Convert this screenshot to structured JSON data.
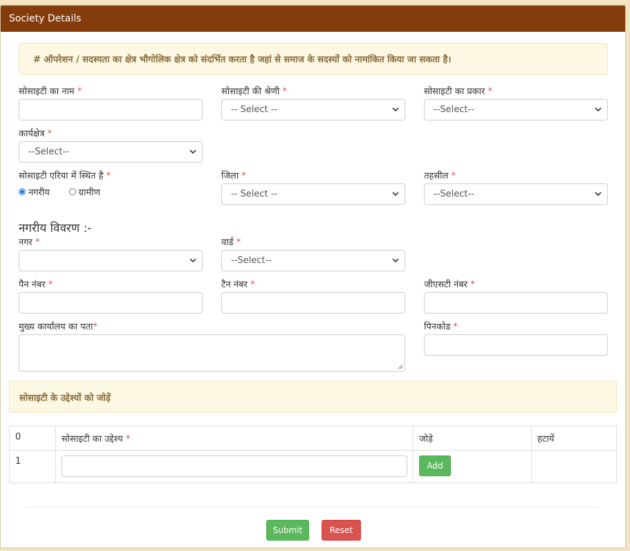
{
  "header": {
    "title": "Society Details"
  },
  "note": "# ऑपरेशन / सदस्यता का क्षेत्र भौगोलिक क्षेत्र को संदर्भित करता है जहां से समाज के सदस्यों को नामांकित किया जा सकता है।",
  "fields": {
    "society_name": {
      "label": "सोसाइटी का नाम",
      "value": ""
    },
    "society_category": {
      "label": "सोसाइटी की श्रेणी",
      "selected": "-- Select --"
    },
    "society_type": {
      "label": "सोसाइटी का प्रकार",
      "selected": "--Select--"
    },
    "work_area": {
      "label": "कार्यक्षेत्र",
      "selected": "--Select--"
    },
    "located_in": {
      "label": "सोसाइटी एरिया में स्थित है",
      "options": [
        "नगरीय",
        "ग्रामीण"
      ],
      "selected": "नगरीय"
    },
    "district": {
      "label": "जिला",
      "selected": "-- Select --"
    },
    "tehsil": {
      "label": "तहसील",
      "selected": "--Select--"
    },
    "city": {
      "label": "नगर",
      "selected": ""
    },
    "ward": {
      "label": "वार्ड",
      "selected": "--Select--"
    },
    "pan": {
      "label": "पैन नंबर",
      "value": ""
    },
    "tan": {
      "label": "टैन नंबर",
      "value": ""
    },
    "gst": {
      "label": "जीएसटी नंबर",
      "value": ""
    },
    "hq_address": {
      "label": "मुख्य कार्यालय का पता",
      "value": ""
    },
    "pincode": {
      "label": "पिनकोड",
      "value": ""
    }
  },
  "urban_section_title": "नगरीय विवरण :-",
  "required_mark": "*",
  "objectives": {
    "bar_title": "सोसाइटी के उद्देश्यों को जोड़ें",
    "columns": [
      "0",
      "सोसाइटी का उद्देश्य",
      "जोड़े",
      "हटायें"
    ],
    "rows": [
      {
        "index": "1",
        "value": "",
        "add_label": "Add"
      }
    ]
  },
  "actions": {
    "submit_label": "Submit",
    "reset_label": "Reset"
  },
  "colors": {
    "header": "#843c0c",
    "note_bg": "#fcf8e3",
    "success": "#5cb85c",
    "danger": "#d9534f"
  }
}
